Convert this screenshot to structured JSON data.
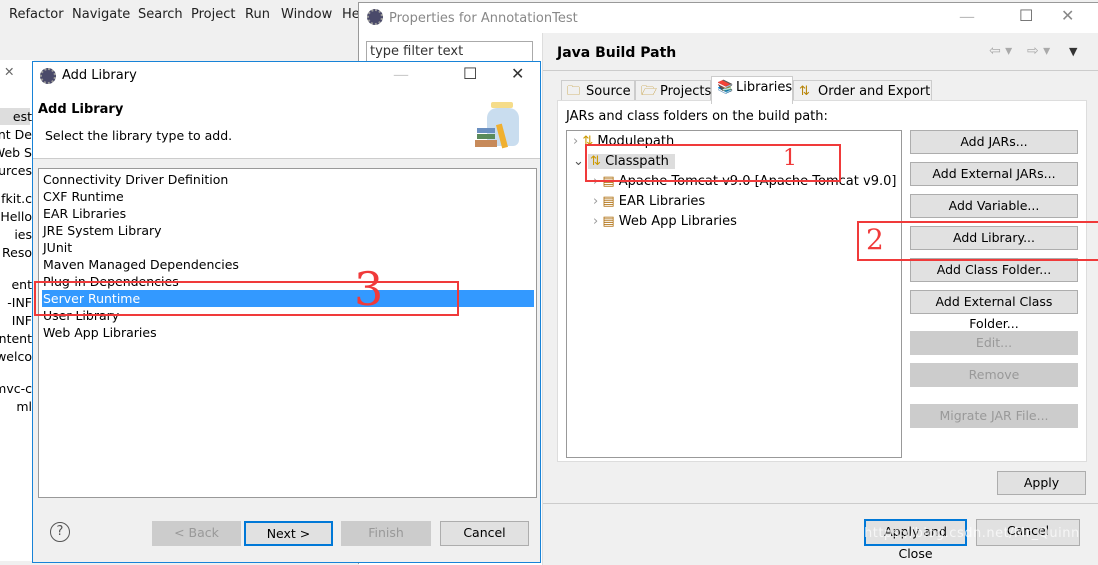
{
  "eclipse": {
    "menu": [
      "Refactor",
      "Navigate",
      "Search",
      "Project",
      "Run",
      "Window",
      "He"
    ],
    "explorer_fragments": [
      "est",
      "ent De",
      "Web S",
      "ources",
      "g.fkit.c",
      "Hello",
      "ies",
      "t Reso",
      "ent",
      "-INF",
      "INF",
      "ntent",
      "welco",
      "mvc-c",
      "ml"
    ]
  },
  "properties": {
    "title": "Properties for AnnotationTest",
    "filter_placeholder": "type filter text",
    "page_title": "Java Build Path",
    "tabs": [
      {
        "label": "Source",
        "icon": "source-folder-icon"
      },
      {
        "label": "Projects",
        "icon": "folder-icon"
      },
      {
        "label": "Libraries",
        "icon": "library-icon",
        "active": true
      },
      {
        "label": "Order and Export",
        "icon": "order-icon"
      }
    ],
    "tree_label": "JARs and class folders on the build path:",
    "tree": [
      {
        "label": "Modulepath",
        "expanded": false
      },
      {
        "label": "Classpath",
        "expanded": true,
        "selected": true
      },
      {
        "label": "Apache Tomcat v9.0 [Apache Tomcat v9.0]",
        "child": true
      },
      {
        "label": "EAR Libraries",
        "child": true
      },
      {
        "label": "Web App Libraries",
        "child": true
      }
    ],
    "buttons": [
      {
        "label": "Add JARs...",
        "enabled": true
      },
      {
        "label": "Add External JARs...",
        "enabled": true
      },
      {
        "label": "Add Variable...",
        "enabled": true
      },
      {
        "label": "Add Library...",
        "enabled": true
      },
      {
        "label": "Add Class Folder...",
        "enabled": true
      },
      {
        "label": "Add External Class Folder...",
        "enabled": true
      },
      {
        "label": "Edit...",
        "enabled": false
      },
      {
        "label": "Remove",
        "enabled": false
      },
      {
        "label": "Migrate JAR File...",
        "enabled": false
      }
    ],
    "apply": "Apply",
    "apply_close": "Apply and Close",
    "cancel": "Cancel"
  },
  "add_library": {
    "title": "Add Library",
    "heading": "Add Library",
    "description": "Select the library type to add.",
    "items": [
      "Connectivity Driver Definition",
      "CXF Runtime",
      "EAR Libraries",
      "JRE System Library",
      "JUnit",
      "Maven Managed Dependencies",
      "Plug-in Dependencies",
      "Server Runtime",
      "User Library",
      "Web App Libraries"
    ],
    "selected": "Server Runtime",
    "back": "< Back",
    "next": "Next >",
    "finish": "Finish",
    "cancel": "Cancel"
  },
  "annotations": [
    "1",
    "2",
    "3"
  ],
  "watermark": "https://blog.csdn.net/Mr_Quinn",
  "colors": {
    "selection": "#3399ff",
    "annotation": "#f03a3a",
    "focus": "#0078d7"
  }
}
